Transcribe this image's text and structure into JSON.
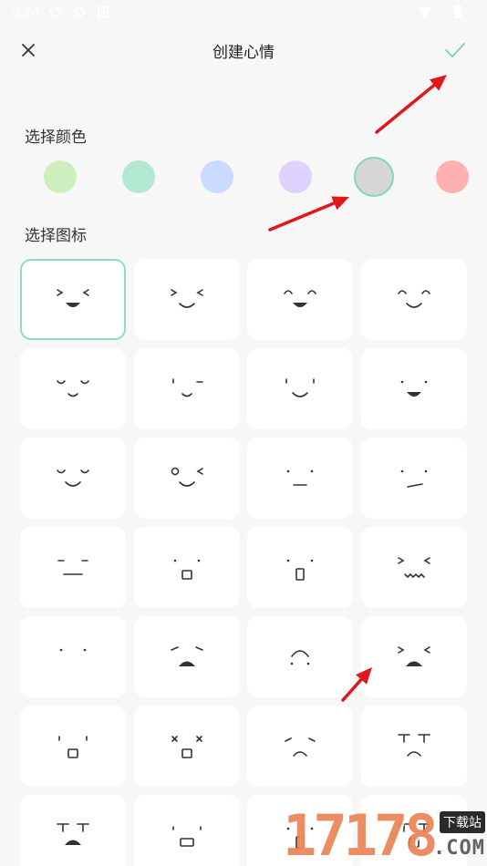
{
  "status_bar": {
    "time": "9:24"
  },
  "header": {
    "title": "创建心情",
    "close_icon": "close-icon",
    "confirm_icon": "check-icon"
  },
  "color_section": {
    "label": "选择颜色",
    "swatches": [
      {
        "name": "light-green",
        "color": "#ccefbd",
        "selected": false
      },
      {
        "name": "mint",
        "color": "#b3e8d3",
        "selected": false
      },
      {
        "name": "light-blue",
        "color": "#c9dcff",
        "selected": false
      },
      {
        "name": "lavender",
        "color": "#e0d2ff",
        "selected": false
      },
      {
        "name": "gray",
        "color": "#d6d6d6",
        "selected": true
      },
      {
        "name": "pink",
        "color": "#ffb0b0",
        "selected": false
      }
    ]
  },
  "icon_section": {
    "label": "选择图标",
    "selected_index": 0,
    "face_icons": [
      "grinning-squint-face-icon",
      "smiling-squint-face-icon",
      "happy-closed-eyes-face-icon",
      "smiling-closed-eyes-face-icon",
      "content-face-icon",
      "winking-face-icon",
      "smiling-face-icon",
      "grinning-face-icon",
      "blissful-face-icon",
      "winking-smile-face-icon",
      "neutral-face-icon",
      "skeptical-face-icon",
      "flat-eyes-face-icon",
      "surprised-face-icon",
      "shocked-face-icon",
      "wavy-mouth-face-icon",
      "blank-face-icon",
      "worried-face-icon",
      "frowning-face-icon",
      "distressed-face-icon",
      "astonished-face-icon",
      "dizzy-face-icon",
      "sad-face-icon",
      "crying-face-icon",
      "sobbing-face-icon",
      "blank-stare-face-icon",
      "gasping-face-icon",
      "tearful-face-icon"
    ]
  },
  "annotation_color": "#e0181a",
  "watermark": {
    "number": "17178",
    "badge": "下载站",
    "domain": ".COM"
  }
}
